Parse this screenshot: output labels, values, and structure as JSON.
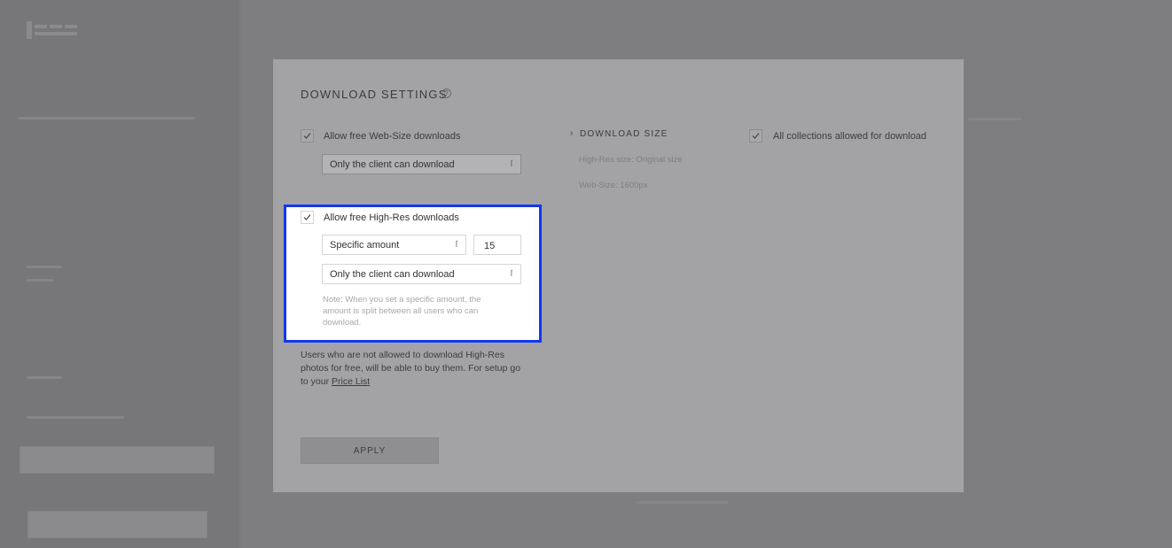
{
  "modal": {
    "title": "DOWNLOAD SETTINGS",
    "help_glyph": "?",
    "web_size": {
      "checkbox_label": "Allow free Web-Size downloads",
      "who_can_download": "Only the client can download"
    },
    "high_res": {
      "checkbox_label": "Allow free High-Res downloads",
      "amount_mode": "Specific amount",
      "amount_value": "15",
      "who_can_download": "Only the client can download",
      "note": "Note: When you set a specific amount, the amount is split between all users who can download."
    },
    "buy_info": {
      "text": "Users who are not allowed to download High-Res photos for free, will be able to buy them. For setup go to your",
      "link": "Price List"
    },
    "download_size": {
      "heading": "DOWNLOAD SIZE",
      "high_res_size": "High-Res size: Original size",
      "web_size": "Web-Size: 1600px"
    },
    "collections": {
      "checkbox_label": "All collections allowed for download"
    },
    "apply_label": "APPLY"
  },
  "colors": {
    "highlight_border": "#1336f0",
    "overlay": "#7c7b7d",
    "modal_bg": "#a3a2a4"
  }
}
